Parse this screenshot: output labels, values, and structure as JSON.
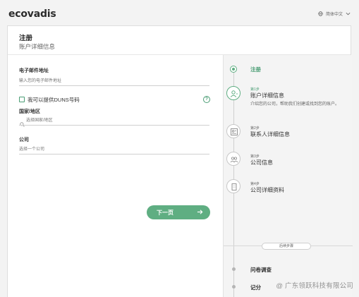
{
  "header": {
    "logo_text": "ecovadis",
    "language": "简体中文"
  },
  "page": {
    "title": "注册",
    "subtitle": "账户详细信息"
  },
  "form": {
    "email": {
      "label": "电子邮件地址",
      "placeholder": "输入您的电子邮件地址"
    },
    "duns_checkbox": {
      "label": "我可以提供DUNS号码",
      "checked": false
    },
    "help_icon_text": "?",
    "country": {
      "label": "国家/地区",
      "placeholder": "选择国家/地区"
    },
    "company": {
      "label": "公司",
      "placeholder": "选择一个公司"
    },
    "next_label": "下一页"
  },
  "sidebar": {
    "register_label": "注册",
    "steps": [
      {
        "number": "第1步",
        "name": "账户详细信息",
        "description": "介绍您的公司，帮助我们创建或找到您的账户。",
        "icon": "user-icon",
        "active": true
      },
      {
        "number": "第2步",
        "name": "联系人详细信息",
        "icon": "contact-card-icon",
        "active": false
      },
      {
        "number": "第3步",
        "name": "公司信息",
        "icon": "people-icon",
        "active": false
      },
      {
        "number": "第4步",
        "name": "公司详细资料",
        "icon": "building-icon",
        "active": false
      }
    ],
    "after_badge": "后续步骤",
    "after_steps": [
      {
        "name": "问卷调查"
      },
      {
        "name": "记分"
      }
    ]
  },
  "watermark": "@ 广东领跃科技有限公司",
  "colors": {
    "accent": "#5fae82",
    "accent_dark": "#4a9d74"
  }
}
